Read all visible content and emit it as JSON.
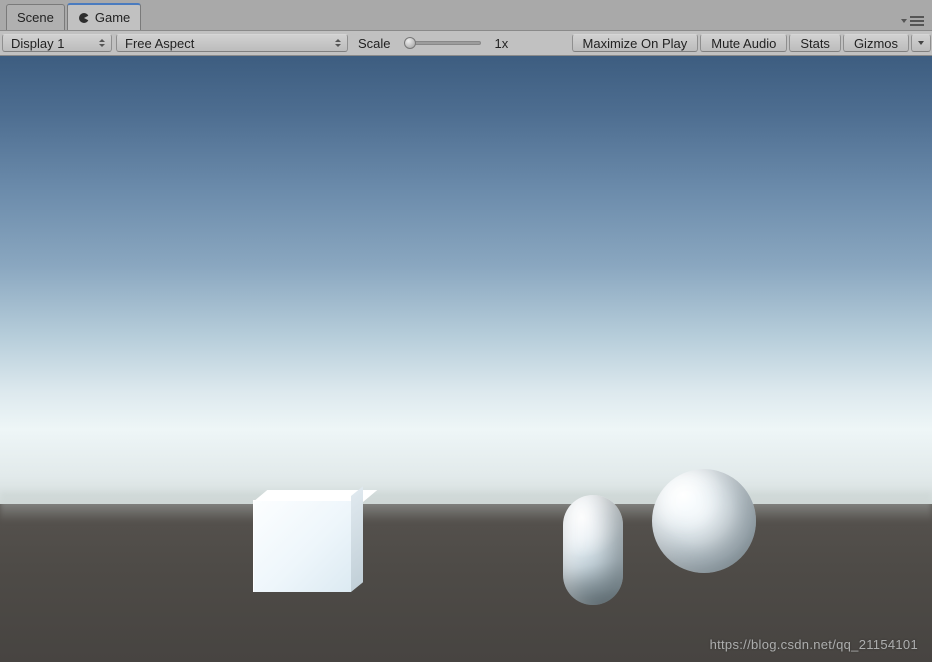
{
  "tabs": {
    "scene": "Scene",
    "game": "Game",
    "active": "game"
  },
  "toolbar": {
    "display_dropdown": "Display 1",
    "aspect_dropdown": "Free Aspect",
    "scale_label": "Scale",
    "scale_value": "1x",
    "maximize_on_play": "Maximize On Play",
    "mute_audio": "Mute Audio",
    "stats": "Stats",
    "gizmos": "Gizmos"
  },
  "scene_objects": {
    "cube": "Cube",
    "capsule": "Capsule",
    "sphere": "Sphere"
  },
  "watermark": "https://blog.csdn.net/qq_21154101"
}
